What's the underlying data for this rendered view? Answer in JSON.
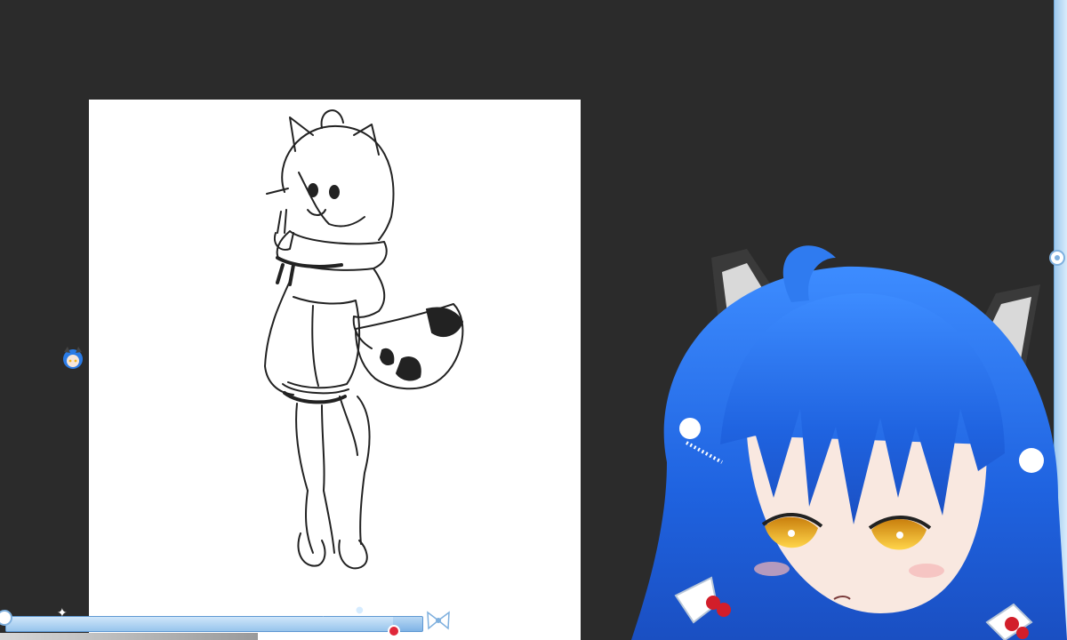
{
  "window": {
    "background_color": "#2b2b2b",
    "accent_color": "#7fb3e6"
  },
  "canvas": {
    "content": "line-art-sketch",
    "background_color": "#ffffff"
  },
  "timeline": {
    "progress": 0.93,
    "thumb_color": "#e0283a"
  },
  "icons": {
    "left_avatar": "chibi-avatar-icon",
    "right_knob": "flower-knob-icon",
    "bar_cap": "flower-knob-icon",
    "bar_decoration": "ribbon-bow-icon"
  },
  "overlay": {
    "type": "vtuber-avatar",
    "hair_color": "#1f63e0",
    "eye_color": "#f2b51c"
  }
}
